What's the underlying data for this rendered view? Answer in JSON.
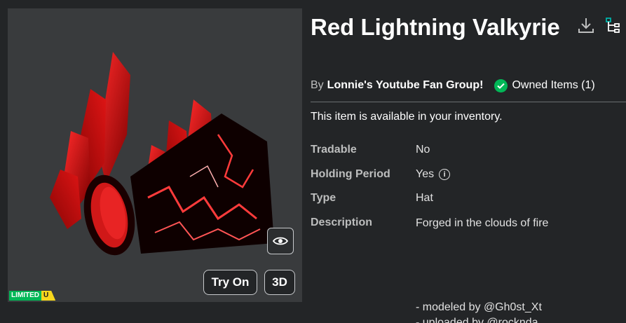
{
  "item": {
    "title": "Red Lightning Valkyrie",
    "by_prefix": "By",
    "creator": "Lonnie's Youtube Fan Group!",
    "owned_label": "Owned Items (1)",
    "availability": "This item is available in your inventory."
  },
  "thumbnail": {
    "buttons": {
      "try_on": "Try On",
      "three_d": "3D"
    },
    "badge": {
      "limited": "LIMITED",
      "unique": "U"
    }
  },
  "details": [
    {
      "label": "Tradable",
      "value": "No"
    },
    {
      "label": "Holding Period",
      "value": "Yes"
    },
    {
      "label": "Type",
      "value": "Hat"
    },
    {
      "label": "Description",
      "value": "Forged in the clouds of fire"
    }
  ],
  "description_extra": {
    "line1": "- modeled by @Gh0st_Xt",
    "line2": "- uploaded by @rocknda"
  },
  "colors": {
    "background": "#232527",
    "thumbnail_bg": "#393b3d",
    "owned_green": "#02b757",
    "limited_green": "#02b757",
    "unique_yellow": "#f8d71d",
    "accent_teal": "#00b2a9"
  },
  "icons": [
    "download-icon",
    "hierarchy-icon",
    "check-icon",
    "info-icon",
    "eye-icon"
  ]
}
